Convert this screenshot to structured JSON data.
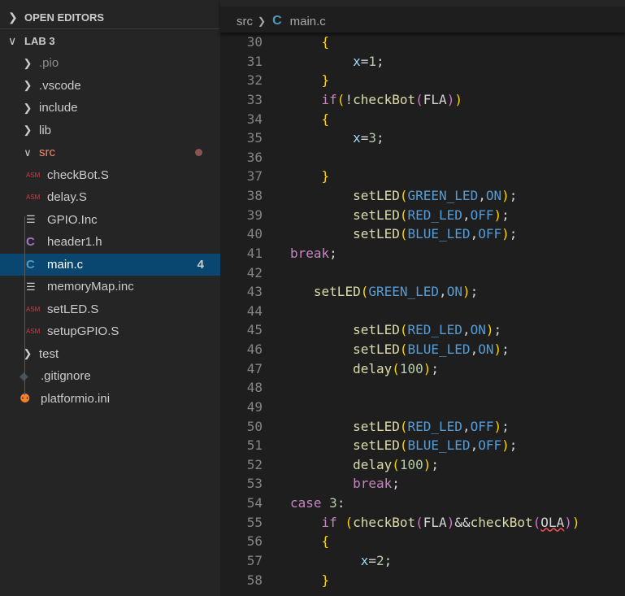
{
  "sidebar": {
    "sections": {
      "open_editors": "OPEN EDITORS",
      "project": "LAB 3"
    },
    "items": [
      {
        "label": ".pio",
        "type": "folder",
        "dim": true
      },
      {
        "label": ".vscode",
        "type": "folder"
      },
      {
        "label": "include",
        "type": "folder"
      },
      {
        "label": "lib",
        "type": "folder"
      },
      {
        "label": "src",
        "type": "folder-open",
        "modified": true
      },
      {
        "label": "checkBot.S",
        "type": "asm",
        "icon_text": "ASM"
      },
      {
        "label": "delay.S",
        "type": "asm",
        "icon_text": "ASM"
      },
      {
        "label": "GPIO.Inc",
        "type": "text"
      },
      {
        "label": "header1.h",
        "type": "h",
        "icon_text": "C"
      },
      {
        "label": "main.c",
        "type": "c",
        "icon_text": "C",
        "selected": true,
        "badge": "4"
      },
      {
        "label": "memoryMap.inc",
        "type": "text"
      },
      {
        "label": "setLED.S",
        "type": "asm",
        "icon_text": "ASM"
      },
      {
        "label": "setupGPIO.S",
        "type": "asm",
        "icon_text": "ASM"
      },
      {
        "label": "test",
        "type": "folder"
      },
      {
        "label": ".gitignore",
        "type": "git"
      },
      {
        "label": "platformio.ini",
        "type": "pio"
      }
    ]
  },
  "breadcrumb": {
    "folder": "src",
    "icon_text": "C",
    "file": "main.c"
  },
  "code": [
    {
      "n": "30",
      "t": [
        [
          "    ",
          "p"
        ],
        [
          "{",
          "b1"
        ]
      ]
    },
    {
      "n": "31",
      "t": [
        [
          "        ",
          "p"
        ],
        [
          "x",
          "v"
        ],
        [
          "=",
          "p"
        ],
        [
          "1",
          "n"
        ],
        [
          ";",
          "p"
        ]
      ]
    },
    {
      "n": "32",
      "t": [
        [
          "    ",
          "p"
        ],
        [
          "}",
          "b1"
        ]
      ]
    },
    {
      "n": "33",
      "t": [
        [
          "    ",
          "p"
        ],
        [
          "if",
          "k"
        ],
        [
          "(",
          "b1"
        ],
        [
          "!",
          "p"
        ],
        [
          "checkBot",
          "f"
        ],
        [
          "(",
          "b2"
        ],
        [
          "FLA",
          "p"
        ],
        [
          ")",
          "b2"
        ],
        [
          ")",
          "b1"
        ]
      ]
    },
    {
      "n": "34",
      "t": [
        [
          "    ",
          "p"
        ],
        [
          "{",
          "b1"
        ]
      ]
    },
    {
      "n": "35",
      "t": [
        [
          "        ",
          "p"
        ],
        [
          "x",
          "v"
        ],
        [
          "=",
          "p"
        ],
        [
          "3",
          "n"
        ],
        [
          ";",
          "p"
        ]
      ]
    },
    {
      "n": "36",
      "t": []
    },
    {
      "n": "37",
      "t": [
        [
          "    ",
          "p"
        ],
        [
          "}",
          "b1"
        ]
      ]
    },
    {
      "n": "38",
      "t": [
        [
          "        ",
          "p"
        ],
        [
          "setLED",
          "f"
        ],
        [
          "(",
          "b1"
        ],
        [
          "GREEN_LED",
          "m"
        ],
        [
          ",",
          "p"
        ],
        [
          "ON",
          "m"
        ],
        [
          ")",
          "b1"
        ],
        [
          ";",
          "p"
        ]
      ]
    },
    {
      "n": "39",
      "t": [
        [
          "        ",
          "p"
        ],
        [
          "setLED",
          "f"
        ],
        [
          "(",
          "b1"
        ],
        [
          "RED_LED",
          "m"
        ],
        [
          ",",
          "p"
        ],
        [
          "OFF",
          "m"
        ],
        [
          ")",
          "b1"
        ],
        [
          ";",
          "p"
        ]
      ]
    },
    {
      "n": "40",
      "t": [
        [
          "        ",
          "p"
        ],
        [
          "setLED",
          "f"
        ],
        [
          "(",
          "b1"
        ],
        [
          "BLUE_LED",
          "m"
        ],
        [
          ",",
          "p"
        ],
        [
          "OFF",
          "m"
        ],
        [
          ")",
          "b1"
        ],
        [
          ";",
          "p"
        ]
      ]
    },
    {
      "n": "41",
      "t": [
        [
          "break",
          "k"
        ],
        [
          ";",
          "p"
        ]
      ]
    },
    {
      "n": "42",
      "t": []
    },
    {
      "n": "43",
      "t": [
        [
          "   ",
          "p"
        ],
        [
          "setLED",
          "f"
        ],
        [
          "(",
          "b1"
        ],
        [
          "GREEN_LED",
          "m"
        ],
        [
          ",",
          "p"
        ],
        [
          "ON",
          "m"
        ],
        [
          ")",
          "b1"
        ],
        [
          ";",
          "p"
        ]
      ]
    },
    {
      "n": "44",
      "t": []
    },
    {
      "n": "45",
      "t": [
        [
          "        ",
          "p"
        ],
        [
          "setLED",
          "f"
        ],
        [
          "(",
          "b1"
        ],
        [
          "RED_LED",
          "m"
        ],
        [
          ",",
          "p"
        ],
        [
          "ON",
          "m"
        ],
        [
          ")",
          "b1"
        ],
        [
          ";",
          "p"
        ]
      ]
    },
    {
      "n": "46",
      "t": [
        [
          "        ",
          "p"
        ],
        [
          "setLED",
          "f"
        ],
        [
          "(",
          "b1"
        ],
        [
          "BLUE_LED",
          "m"
        ],
        [
          ",",
          "p"
        ],
        [
          "ON",
          "m"
        ],
        [
          ")",
          "b1"
        ],
        [
          ";",
          "p"
        ]
      ]
    },
    {
      "n": "47",
      "t": [
        [
          "        ",
          "p"
        ],
        [
          "delay",
          "f"
        ],
        [
          "(",
          "b1"
        ],
        [
          "100",
          "n"
        ],
        [
          ")",
          "b1"
        ],
        [
          ";",
          "p"
        ]
      ]
    },
    {
      "n": "48",
      "t": []
    },
    {
      "n": "49",
      "t": []
    },
    {
      "n": "50",
      "t": [
        [
          "        ",
          "p"
        ],
        [
          "setLED",
          "f"
        ],
        [
          "(",
          "b1"
        ],
        [
          "RED_LED",
          "m"
        ],
        [
          ",",
          "p"
        ],
        [
          "OFF",
          "m"
        ],
        [
          ")",
          "b1"
        ],
        [
          ";",
          "p"
        ]
      ]
    },
    {
      "n": "51",
      "t": [
        [
          "        ",
          "p"
        ],
        [
          "setLED",
          "f"
        ],
        [
          "(",
          "b1"
        ],
        [
          "BLUE_LED",
          "m"
        ],
        [
          ",",
          "p"
        ],
        [
          "OFF",
          "m"
        ],
        [
          ")",
          "b1"
        ],
        [
          ";",
          "p"
        ]
      ]
    },
    {
      "n": "52",
      "t": [
        [
          "        ",
          "p"
        ],
        [
          "delay",
          "f"
        ],
        [
          "(",
          "b1"
        ],
        [
          "100",
          "n"
        ],
        [
          ")",
          "b1"
        ],
        [
          ";",
          "p"
        ]
      ]
    },
    {
      "n": "53",
      "t": [
        [
          "        ",
          "p"
        ],
        [
          "break",
          "k"
        ],
        [
          ";",
          "p"
        ]
      ]
    },
    {
      "n": "54",
      "t": [
        [
          "case",
          "k"
        ],
        [
          " ",
          "p"
        ],
        [
          "3",
          "n"
        ],
        [
          ":",
          "p"
        ]
      ]
    },
    {
      "n": "55",
      "t": [
        [
          "    ",
          "p"
        ],
        [
          "if",
          "k"
        ],
        [
          " ",
          "p"
        ],
        [
          "(",
          "b1"
        ],
        [
          "checkBot",
          "f"
        ],
        [
          "(",
          "b2"
        ],
        [
          "FLA",
          "p"
        ],
        [
          ")",
          "b2"
        ],
        [
          "&&",
          "p"
        ],
        [
          "checkBot",
          "f"
        ],
        [
          "(",
          "b2"
        ],
        [
          "OLA",
          "p sq"
        ],
        [
          ")",
          "b2"
        ],
        [
          ")",
          "b1"
        ]
      ]
    },
    {
      "n": "56",
      "t": [
        [
          "    ",
          "p"
        ],
        [
          "{",
          "b1"
        ]
      ]
    },
    {
      "n": "57",
      "t": [
        [
          "         ",
          "p"
        ],
        [
          "x",
          "v"
        ],
        [
          "=",
          "p"
        ],
        [
          "2",
          "n"
        ],
        [
          ";",
          "p"
        ]
      ]
    },
    {
      "n": "58",
      "t": [
        [
          "    ",
          "p"
        ],
        [
          "}",
          "b1"
        ]
      ]
    }
  ]
}
